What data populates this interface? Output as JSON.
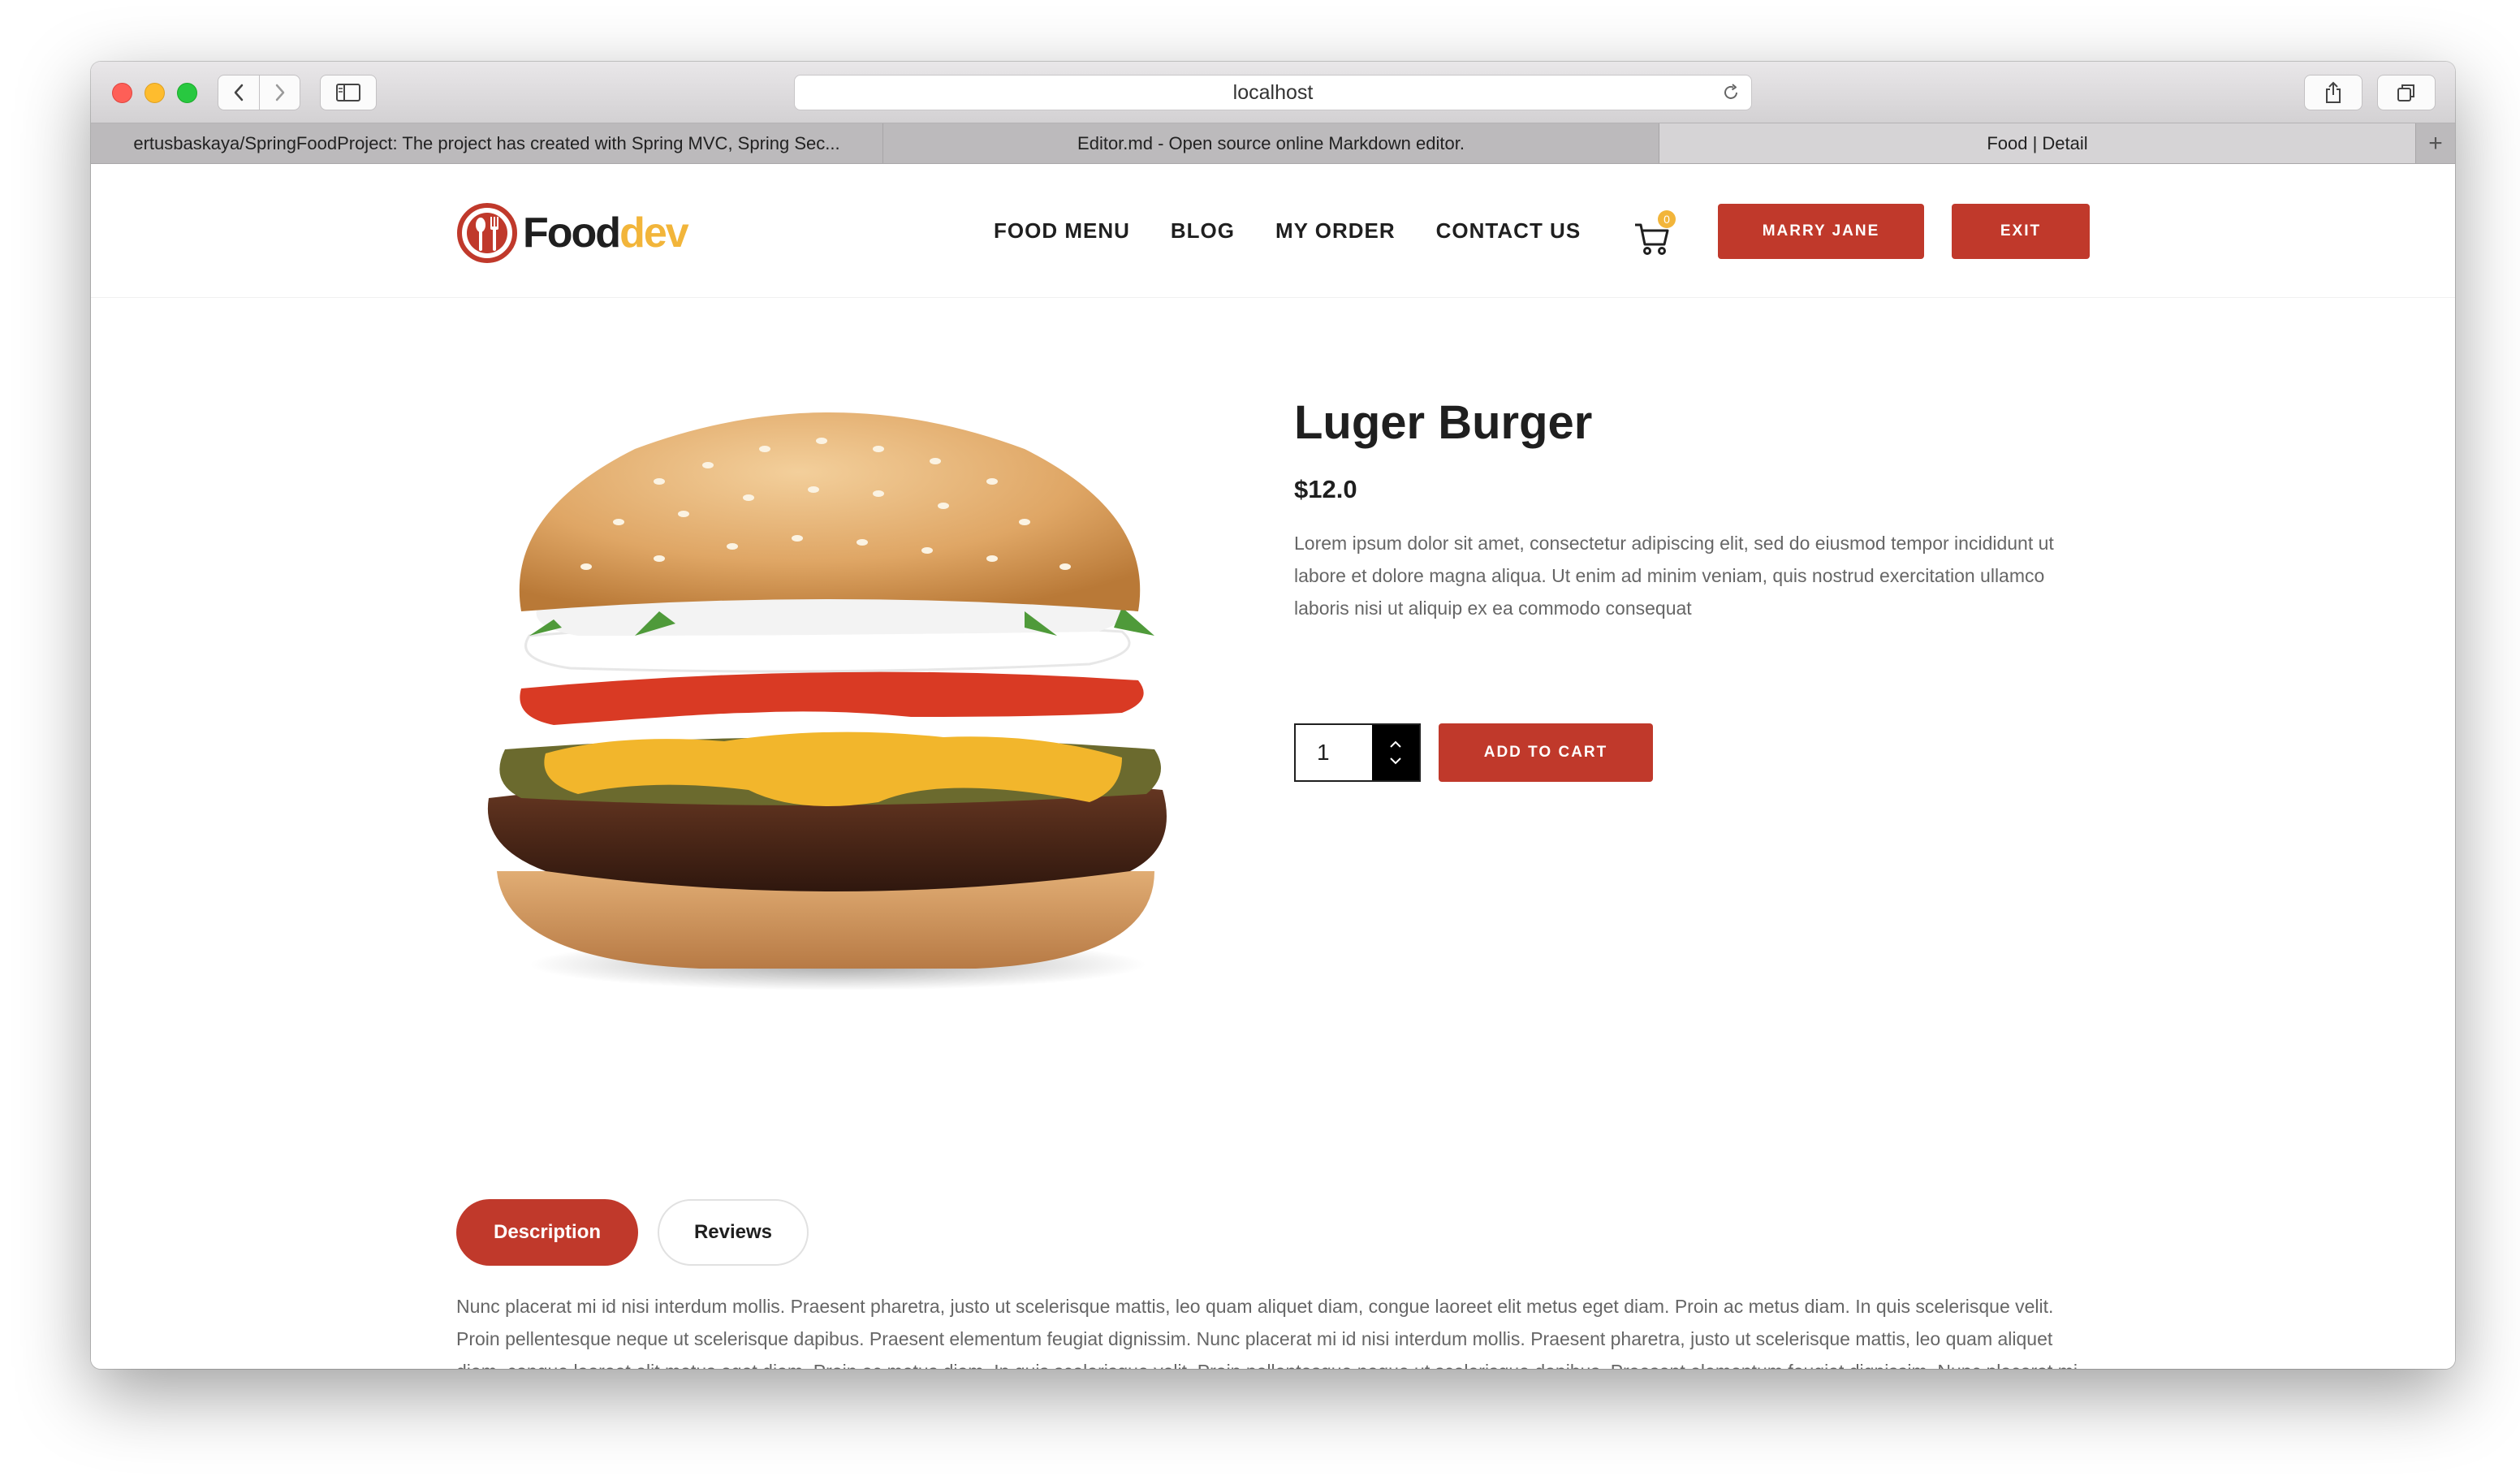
{
  "browser": {
    "url": "localhost",
    "tabs": [
      {
        "title": "ertusbaskaya/SpringFoodProject: The project has created with Spring MVC, Spring Sec...",
        "active": false
      },
      {
        "title": "Editor.md - Open source online Markdown editor.",
        "active": false
      },
      {
        "title": "Food | Detail",
        "active": true
      }
    ],
    "new_tab_label": "+"
  },
  "site": {
    "logo": {
      "part1": "Food",
      "part2": "dev"
    },
    "menu": [
      "FOOD MENU",
      "BLOG",
      "MY ORDER",
      "CONTACT US"
    ],
    "cart_count": "0",
    "user_button": "MARRY JANE",
    "exit_button": "EXIT"
  },
  "product": {
    "name": "Luger Burger",
    "price": "$12.0",
    "description": "Lorem ipsum dolor sit amet, consectetur adipiscing elit, sed do eiusmod tempor incididunt ut labore et dolore magna aliqua. Ut enim ad minim veniam, quis nostrud exercitation ullamco laboris nisi ut aliquip ex ea commodo consequat",
    "quantity": "1",
    "add_to_cart": "ADD TO CART"
  },
  "detail_tabs": {
    "description_label": "Description",
    "reviews_label": "Reviews",
    "active": "Description",
    "body": "Nunc placerat mi id nisi interdum mollis. Praesent pharetra, justo ut scelerisque mattis, leo quam aliquet diam, congue laoreet elit metus eget diam. Proin ac metus diam. In quis scelerisque velit. Proin pellentesque neque ut scelerisque dapibus. Praesent elementum feugiat dignissim. Nunc placerat mi id nisi interdum mollis. Praesent pharetra, justo ut scelerisque mattis, leo quam aliquet diam, congue laoreet elit metus eget diam. Proin ac metus diam. In quis scelerisque velit. Proin pellentesque neque ut scelerisque dapibus. Praesent elementum feugiat dignissim. Nunc placerat mi id nisi interdum mollis. Praesent pharetra, justo ut scelerisque mattis, leo quam aliquet diam, congue laoreet elit metus eget diam."
  },
  "colors": {
    "brand_red": "#c0392b",
    "brand_yellow": "#f2b53a",
    "text_dark": "#1f1f1f",
    "text_muted": "#666666"
  }
}
